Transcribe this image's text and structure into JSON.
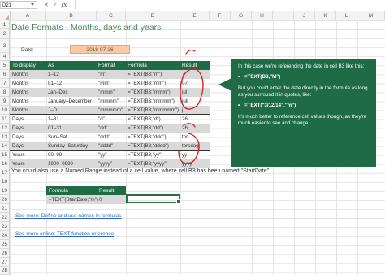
{
  "formula_bar": {
    "name_box": "D21",
    "cancel_icon": "✕",
    "enter_icon": "✓",
    "fx_label": "fx",
    "formula": ""
  },
  "columns": [
    "A",
    "B",
    "C",
    "D",
    "E",
    "F",
    "G",
    "H",
    "I",
    "J",
    "K",
    "L",
    "M"
  ],
  "rows": [
    "1",
    "2",
    "3",
    "4",
    "5",
    "6",
    "7",
    "8",
    "9",
    "10",
    "11",
    "12",
    "13",
    "14",
    "15",
    "16",
    "17",
    "18",
    "19",
    "20",
    "21",
    "22",
    "23",
    "24",
    "25",
    "26",
    "27",
    "28"
  ],
  "title": "Date Formats - Months, days and years",
  "date_label": "Date:",
  "date_value": "2018-07-26",
  "table": {
    "headers": [
      "To display",
      "As",
      "Format",
      "Formula",
      "Result"
    ],
    "rows": [
      [
        "Months",
        "1–12",
        "\"m\"",
        "=TEXT(B3;\"m\")",
        "7"
      ],
      [
        "Months",
        "01–12",
        "\"mm\"",
        "=TEXT(B3;\"mm\")",
        "07"
      ],
      [
        "Months",
        "Jan–Dec",
        "\"mmm\"",
        "=TEXT(B3;\"mmm\")",
        "jul"
      ],
      [
        "Months",
        "January–December",
        "\"mmmm\"",
        "=TEXT(B3;\"mmmm\")",
        "juli"
      ],
      [
        "Months",
        "J–D",
        "\"mmmmm\"",
        "=TEXT(B3;\"mmmmm\")",
        "j"
      ],
      [
        "Days",
        "1–31",
        "\"d\"",
        "=TEXT(B3;\"d\")",
        "26"
      ],
      [
        "Days",
        "01–31",
        "\"dd\"",
        "=TEXT(B3;\"dd\")",
        "26"
      ],
      [
        "Days",
        "Sun–Sat",
        "\"ddd\"",
        "=TEXT(B3;\"ddd\")",
        "tor"
      ],
      [
        "Days",
        "Sunday–Saturday",
        "\"dddd\"",
        "=TEXT(B3;\"dddd\")",
        "torsdag"
      ],
      [
        "Years",
        "00–99",
        "\"yy\"",
        "=TEXT(B3;\"yy\")",
        "yy"
      ],
      [
        "Years",
        "1900–9999",
        "\"yyyy\"",
        "=TEXT(B3;\"yyyy\")",
        "yyyy"
      ]
    ]
  },
  "named_range_note": "You could also use a Named Range instead of a cell value, where cell B3 has been named \"StartDate\".",
  "mini_table": {
    "headers": [
      "Formula",
      "Result"
    ],
    "row": [
      "=TEXT(StartDate;\"m\")",
      "0"
    ]
  },
  "links": [
    "See more: Define and use names in formulas",
    "See more online: TEXT function reference"
  ],
  "callout": {
    "p1": "In this case we're referencing the date in cell B3 like this:",
    "b1": "=TEXT(B3,\"M\")",
    "p2": "But you could enter the date directly in the formula as long as you surround it in quotes, like:",
    "b2": "=TEXT(\"3/12/14\",\"m\")",
    "p3": "It's much better to reference cell values though, as they're much easier to see and change."
  },
  "colors": {
    "header_green": "#1e6b45",
    "date_fill": "#f8c9a4",
    "row_shade": "#d9d9d9",
    "title_green": "#4a8a5a",
    "annotation_red": "#e02020",
    "link_blue": "#2b66c2"
  }
}
